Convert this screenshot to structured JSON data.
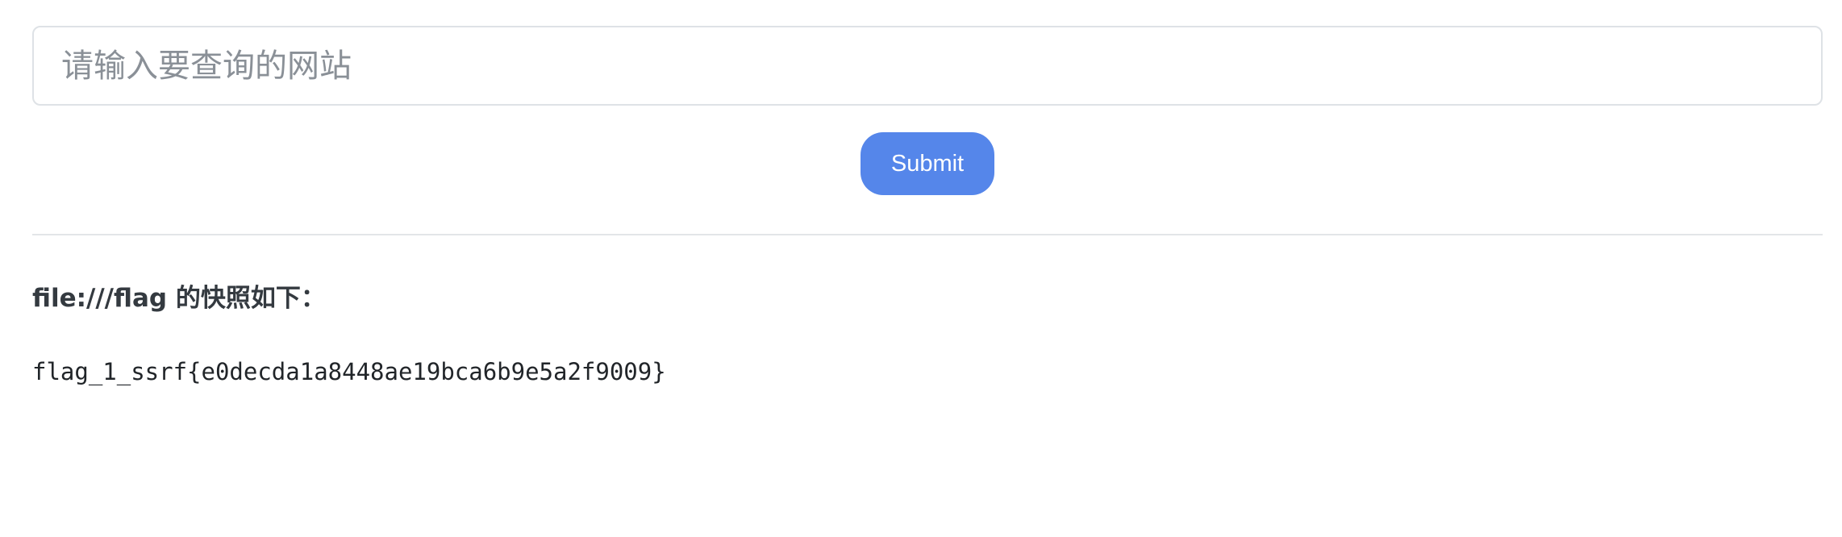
{
  "search": {
    "placeholder": "请输入要查询的网站",
    "value": ""
  },
  "form": {
    "submit_label": "Submit"
  },
  "result": {
    "url": "file:///flag",
    "heading_suffix": " 的快照如下：",
    "content": "flag_1_ssrf{e0decda1a8448ae19bca6b9e5a2f9009}"
  },
  "colors": {
    "button_bg": "#5586ea",
    "border": "#dee2e6",
    "placeholder": "#8a9097"
  }
}
